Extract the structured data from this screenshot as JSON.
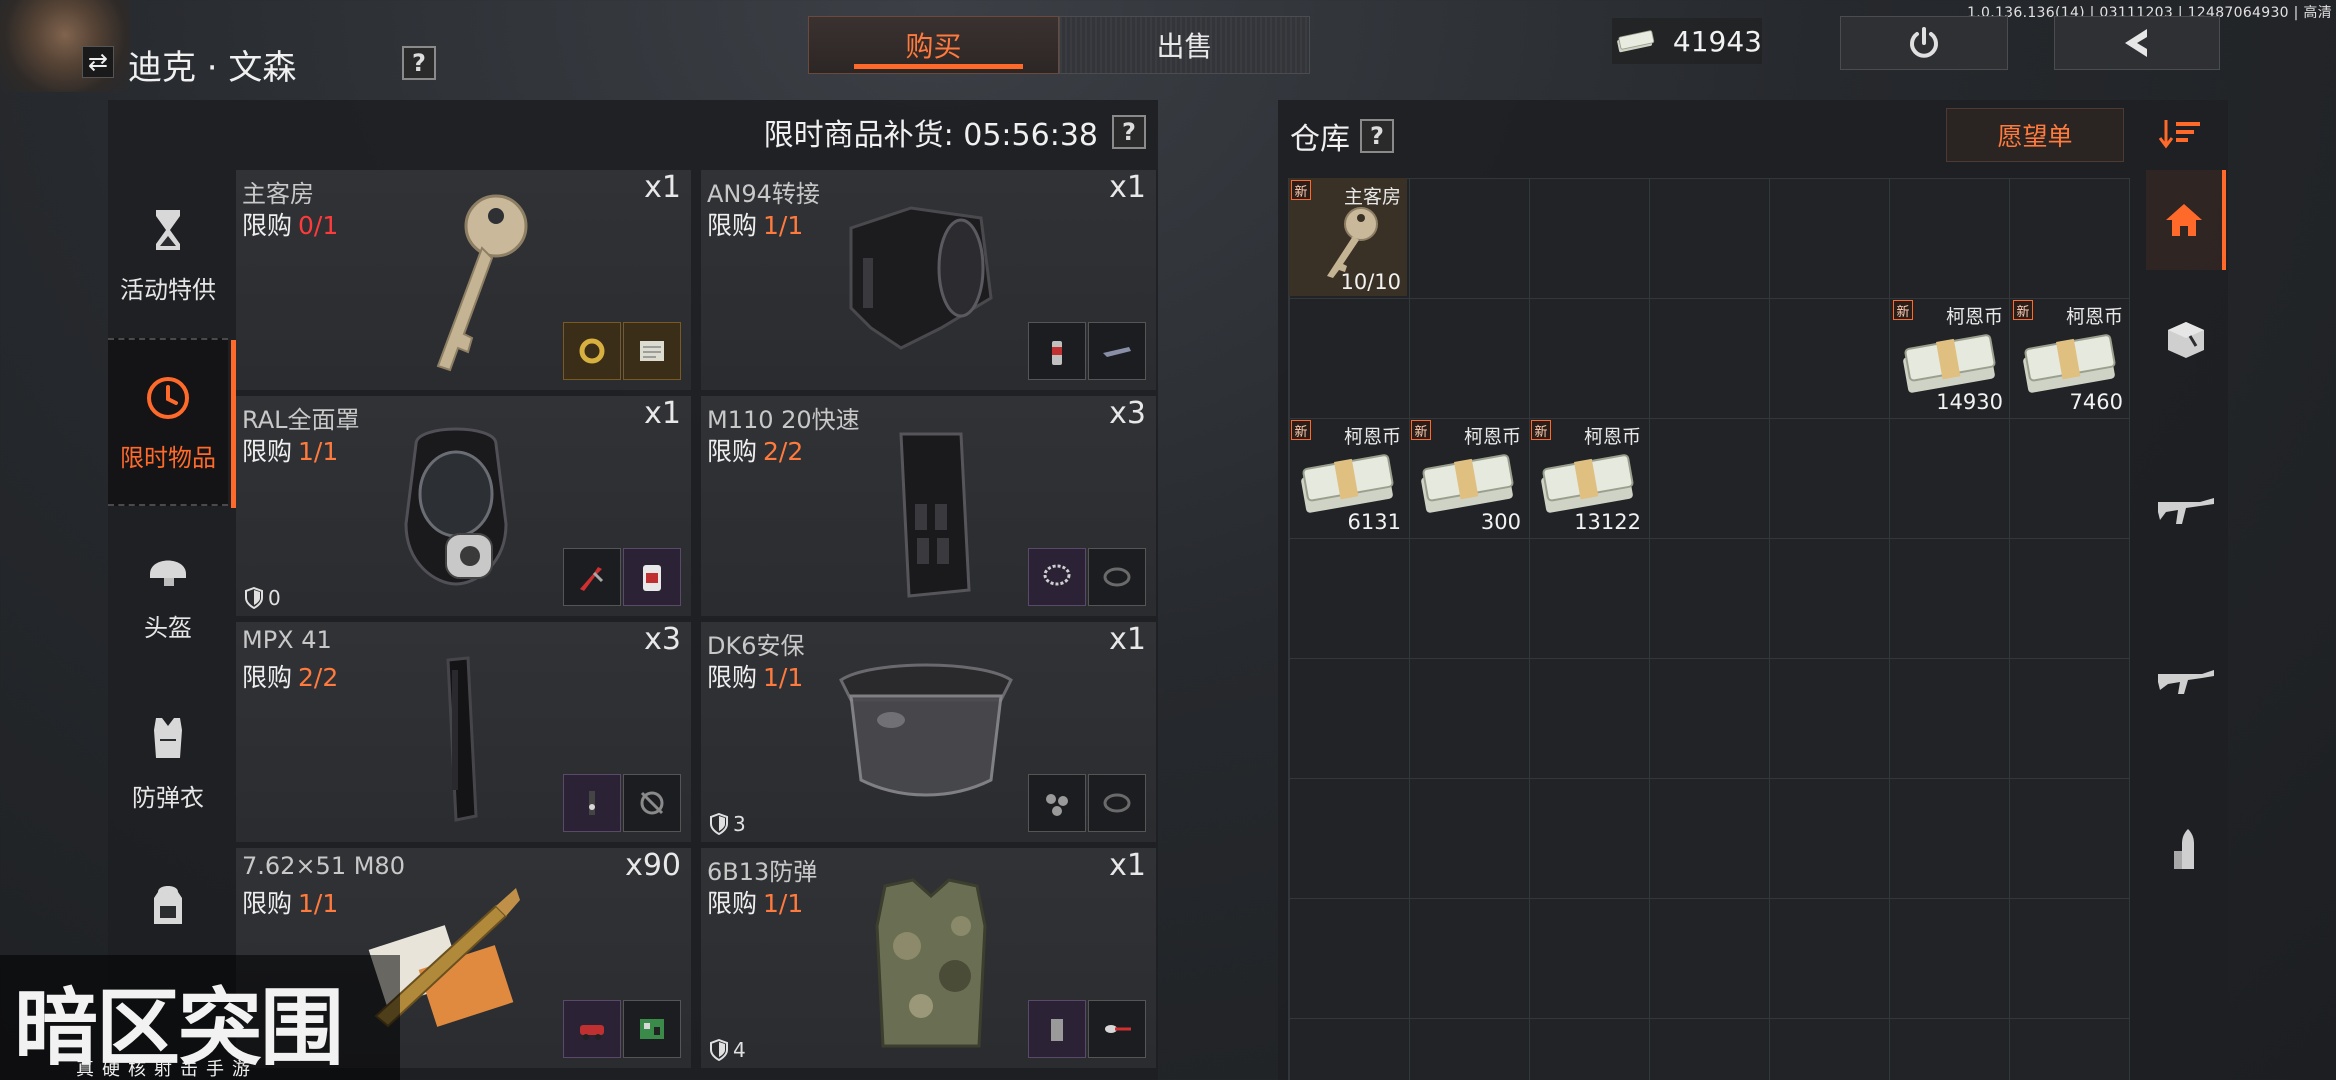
{
  "version": "1.0.136.136(14) | 03111203 | 12487064930 | 高清",
  "trader": {
    "name": "迪克 · 文森",
    "swap_icon": "swap-icon",
    "help": "?"
  },
  "tabs": [
    {
      "label": "购买",
      "active": true
    },
    {
      "label": "出售",
      "active": false
    }
  ],
  "currency": {
    "icon": "cash-icon",
    "value": "41943"
  },
  "header_buttons": {
    "power": "power-icon",
    "back": "back-chevron-icon"
  },
  "shop": {
    "restock_label": "限时商品补货: 05:56:38",
    "help": "?",
    "limit_prefix": "限购",
    "categories": [
      {
        "label": "活动特供",
        "icon": "hourglass-icon",
        "active": false
      },
      {
        "label": "限时物品",
        "icon": "clock-icon",
        "active": true
      },
      {
        "label": "头盔",
        "icon": "helmet-icon",
        "active": false
      },
      {
        "label": "防弹衣",
        "icon": "vest-icon",
        "active": false
      },
      {
        "label": "",
        "icon": "backpack-icon",
        "active": false
      }
    ],
    "items": [
      {
        "name": "主客房",
        "limit": "0/1",
        "limit_zero": true,
        "qty": "x1",
        "art": "key-icon",
        "materials": [
          "gold-ring-icon",
          "paper-icon"
        ],
        "armor": ""
      },
      {
        "name": "AN94转接",
        "limit": "1/1",
        "qty": "x1",
        "art": "adapter-icon",
        "materials": [
          "spray-can-icon",
          "rifle-part-icon"
        ],
        "armor": ""
      },
      {
        "name": "RAL全面罩",
        "limit": "1/1",
        "qty": "x1",
        "art": "gas-mask-icon",
        "materials": [
          "pliers-icon",
          "snack-bag-icon"
        ],
        "armor": "0"
      },
      {
        "name": "M110 20快速",
        "limit": "2/2",
        "qty": "x3",
        "art": "magazine-icon",
        "materials": [
          "necklace-icon",
          "cable-icon"
        ],
        "armor": ""
      },
      {
        "name": "MPX 41",
        "limit": "2/2",
        "qty": "x3",
        "art": "long-magazine-icon",
        "materials": [
          "tag-icon",
          "compass-icon"
        ],
        "armor": ""
      },
      {
        "name": "DK6安保",
        "limit": "1/1",
        "qty": "x1",
        "art": "visor-icon",
        "materials": [
          "parts-icon",
          "cable-icon"
        ],
        "armor": "3"
      },
      {
        "name": "7.62×51 M80",
        "limit": "1/1",
        "qty": "x90",
        "art": "ammo-box-icon",
        "materials": [
          "toy-car-icon",
          "circuit-board-icon"
        ],
        "armor": ""
      },
      {
        "name": "6B13防弹",
        "limit": "1/1",
        "qty": "x1",
        "art": "body-armor-icon",
        "materials": [
          "battery-icon",
          "spoon-icon"
        ],
        "armor": "4"
      }
    ]
  },
  "stash": {
    "title": "仓库",
    "help": "?",
    "wishlist_label": "愿望单",
    "sort_icon": "sort-icon",
    "new_badge": "新",
    "slots": [
      {
        "name": "主客房",
        "count": "10/10",
        "art": "key-icon"
      },
      {
        "name": "柯恩币",
        "count": "14930",
        "art": "cash-stack-icon"
      },
      {
        "name": "柯恩币",
        "count": "7460",
        "art": "cash-stack-icon"
      },
      {
        "name": "柯恩币",
        "count": "6131",
        "art": "cash-stack-icon"
      },
      {
        "name": "柯恩币",
        "count": "300",
        "art": "cash-stack-icon"
      },
      {
        "name": "柯恩币",
        "count": "13122",
        "art": "cash-stack-icon"
      }
    ],
    "side_filters": [
      {
        "icon": "home-icon",
        "active": true
      },
      {
        "icon": "cube-icon",
        "active": false
      },
      {
        "icon": "assault-rifle-icon",
        "active": false
      },
      {
        "icon": "rifle-icon",
        "active": false
      },
      {
        "icon": "bullet-icon",
        "active": false
      }
    ]
  },
  "logo": {
    "title": "暗区突围",
    "subtitle": "真硬核射击手游"
  },
  "colors": {
    "accent": "#ff6a2a",
    "limit_zero": "#ff3a3a",
    "panel": "#1e2023"
  }
}
